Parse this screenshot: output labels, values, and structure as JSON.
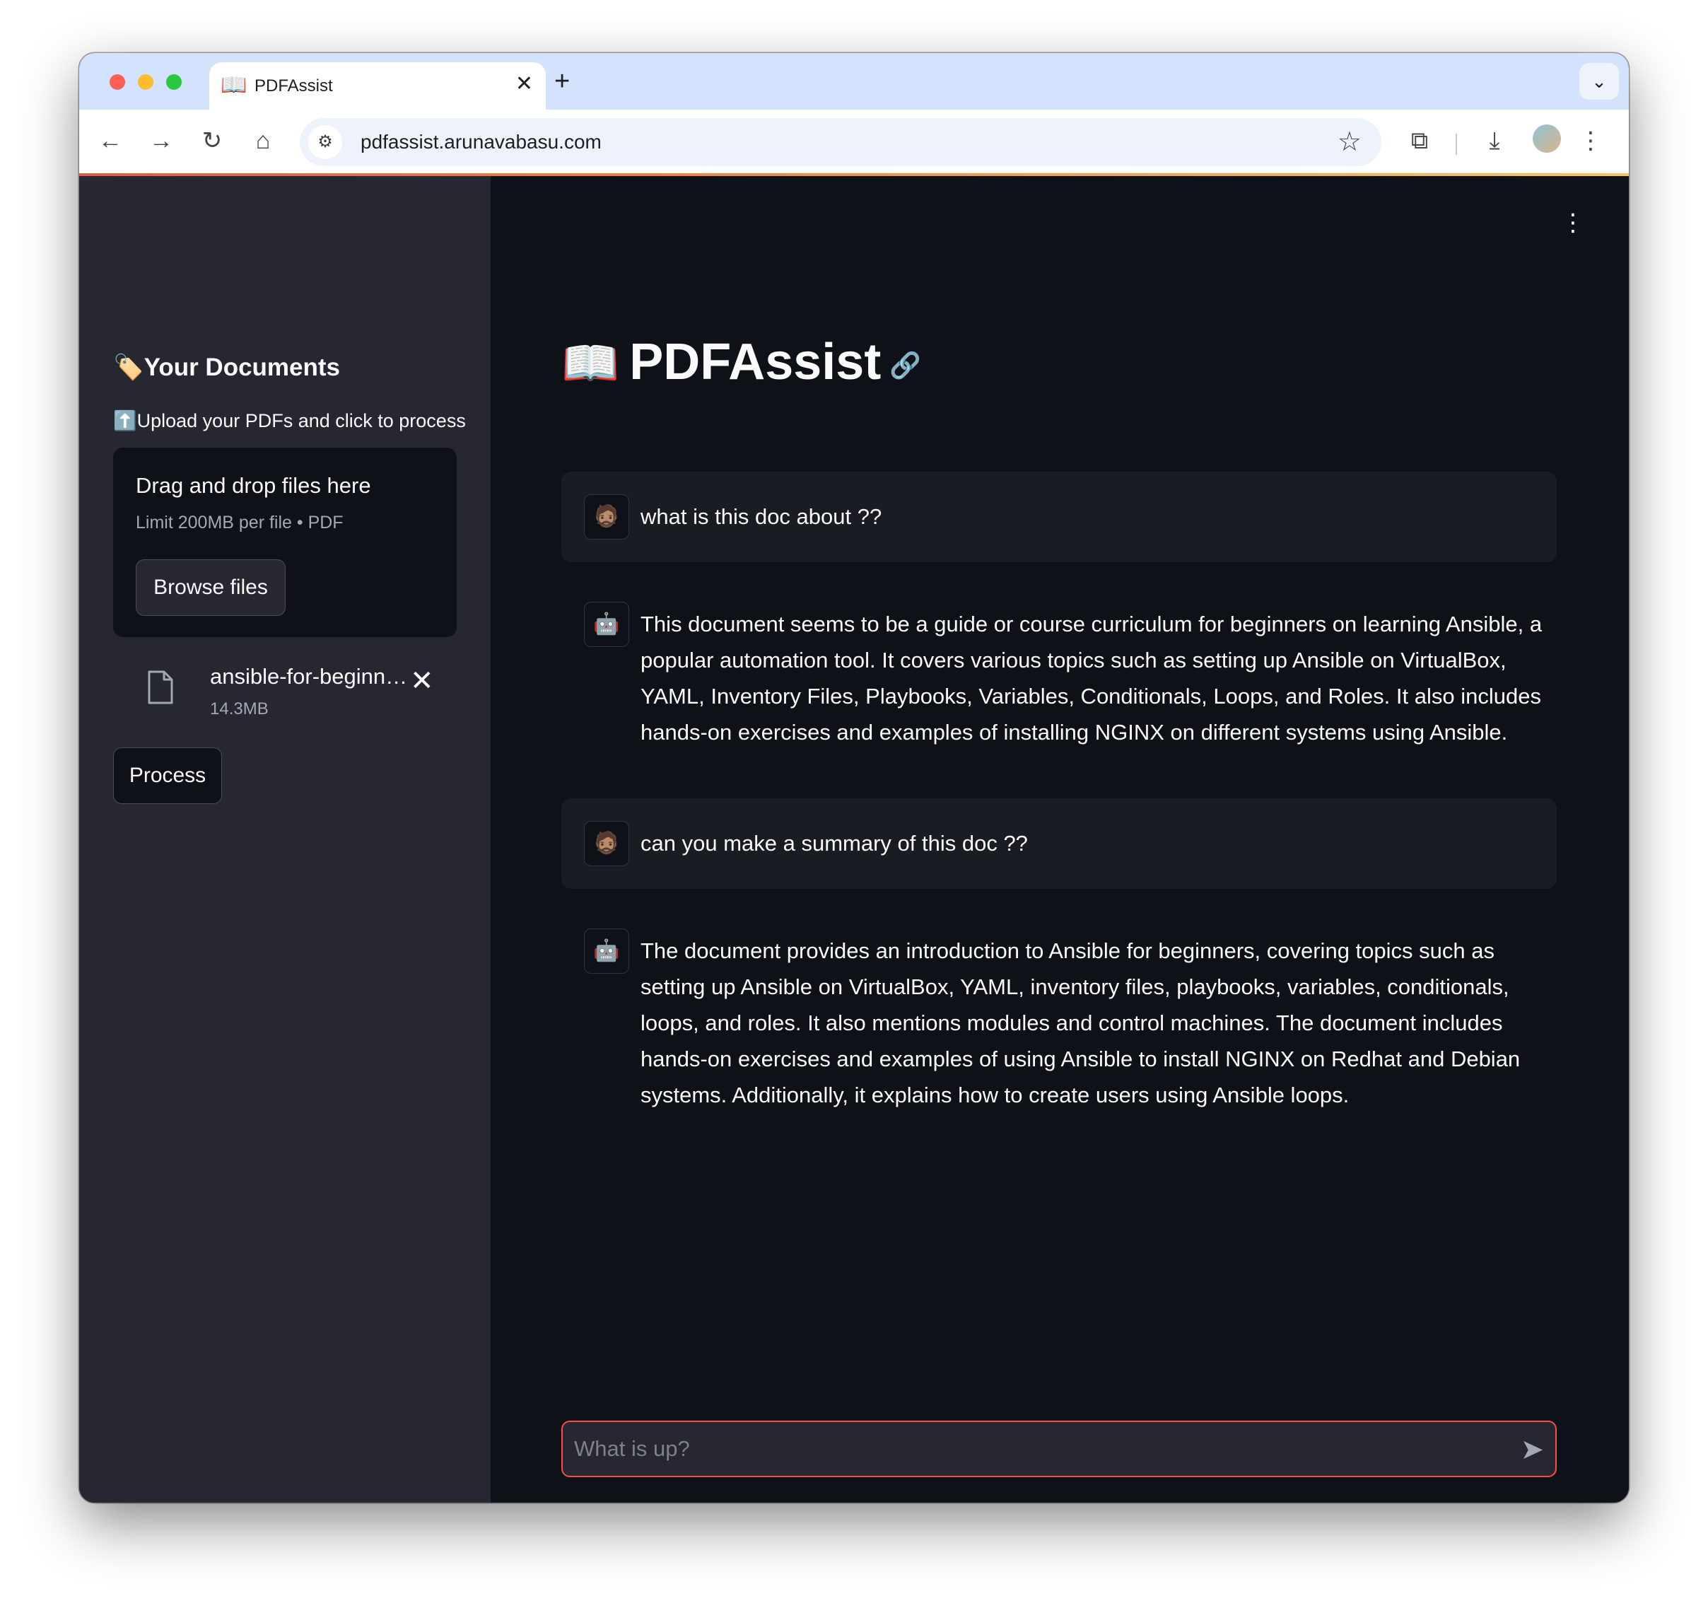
{
  "browser": {
    "tab_icon": "📖",
    "tab_title": "PDFAssist",
    "close_tab": "✕",
    "new_tab": "+",
    "tab_list": "⌄",
    "url": "pdfassist.arunavabasu.com",
    "icons": {
      "back": "←",
      "forward": "→",
      "reload": "↻",
      "home": "⌂",
      "site_info": "⚙",
      "bookmark": "☆",
      "extensions": "⧉",
      "download": "⤓",
      "menu": "⋮"
    }
  },
  "sidebar": {
    "heading": "🏷️Your Documents",
    "subheading": "⬆️Upload your PDFs and click to process",
    "dropzone": {
      "title": "Drag and drop files here",
      "limit": "Limit 200MB per file • PDF",
      "browse_label": "Browse files"
    },
    "file": {
      "name": "ansible-for-beginn…",
      "size": "14.3MB",
      "remove": "✕"
    },
    "process_label": "Process"
  },
  "main": {
    "menu_icon": "⋮",
    "title_icon": "📖",
    "title": "PDFAssist",
    "title_link_icon": "🔗",
    "messages": [
      {
        "role": "user",
        "avatar": "🧔🏽",
        "text": "what is this doc about ??"
      },
      {
        "role": "assistant",
        "avatar": "🤖",
        "text": "This document seems to be a guide or course curriculum for beginners on learning Ansible, a popular automation tool. It covers various topics such as setting up Ansible on VirtualBox, YAML, Inventory Files, Playbooks, Variables, Conditionals, Loops, and Roles. It also includes hands-on exercises and examples of installing NGINX on different systems using Ansible."
      },
      {
        "role": "user",
        "avatar": "🧔🏽",
        "text": "can you make a summary of this doc ??"
      },
      {
        "role": "assistant",
        "avatar": "🤖",
        "text": "The document provides an introduction to Ansible for beginners, covering topics such as setting up Ansible on VirtualBox, YAML, inventory files, playbooks, variables, conditionals, loops, and roles. It also mentions modules and control machines. The document includes hands-on exercises and examples of using Ansible to install NGINX on Redhat and Debian systems. Additionally, it explains how to create users using Ansible loops."
      }
    ],
    "chat_input": {
      "placeholder": "What is up?",
      "value": "",
      "send_icon": "➤"
    }
  },
  "colors": {
    "sidebar_bg": "#262730",
    "main_bg": "#0e1117",
    "user_msg_bg": "#1a1c24",
    "accent": "#ff4b4b",
    "text": "#fafafa"
  }
}
